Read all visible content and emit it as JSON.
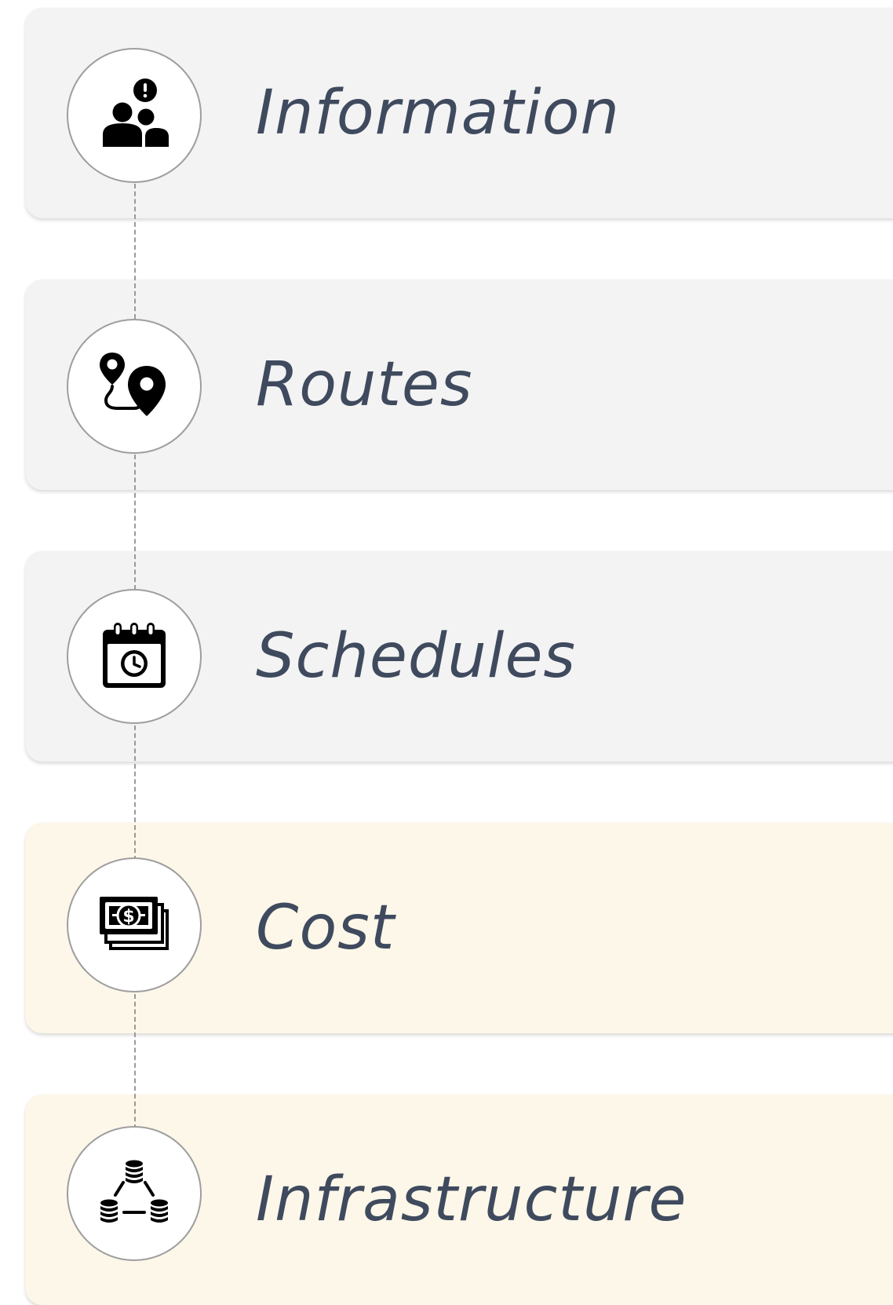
{
  "steps": [
    {
      "label": "Information",
      "icon": "user-group-alert-icon",
      "theme": "gray"
    },
    {
      "label": "Routes",
      "icon": "route-pins-icon",
      "theme": "gray"
    },
    {
      "label": "Schedules",
      "icon": "calendar-clock-icon",
      "theme": "gray"
    },
    {
      "label": "Cost",
      "icon": "money-stack-icon",
      "theme": "cream"
    },
    {
      "label": "Infrastructure",
      "icon": "database-network-icon",
      "theme": "cream"
    }
  ],
  "colors": {
    "card_gray": "#f3f3f3",
    "card_cream": "#fcf7e8",
    "label_text": "#3f4a5e",
    "connector": "#9a9a9a",
    "circle_border": "#9e9e9e"
  }
}
